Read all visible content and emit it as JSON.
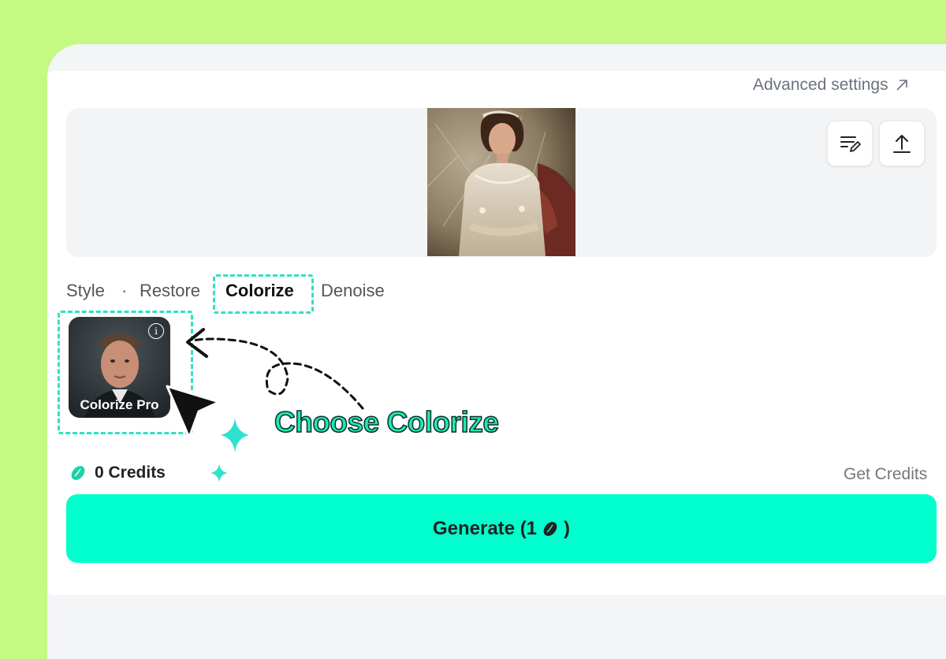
{
  "header": {
    "advanced_settings_label": "Advanced settings",
    "advanced_icon": "arrow-up-right-icon"
  },
  "preview": {
    "edit_icon": "edit-list-icon",
    "upload_icon": "upload-icon"
  },
  "tabs": [
    {
      "label": "Style"
    },
    {
      "label": "·"
    },
    {
      "label": "Restore"
    },
    {
      "label": "Colorize",
      "active": true
    },
    {
      "label": "Denoise"
    }
  ],
  "model": {
    "label": "Colorize Pro",
    "info_icon": "info-icon",
    "info_glyph": "i"
  },
  "annotation": {
    "text": "Choose Colorize"
  },
  "credits": {
    "amount": "0 Credits",
    "get_label": "Get Credits",
    "icon": "bean-icon"
  },
  "generate": {
    "label": "Generate (1",
    "suffix": ")",
    "icon": "bean-icon"
  },
  "colors": {
    "accent": "#00ffcc",
    "annotation": "#1de9b6",
    "dashed": "#2ee2c0",
    "background": "#c6f884"
  }
}
